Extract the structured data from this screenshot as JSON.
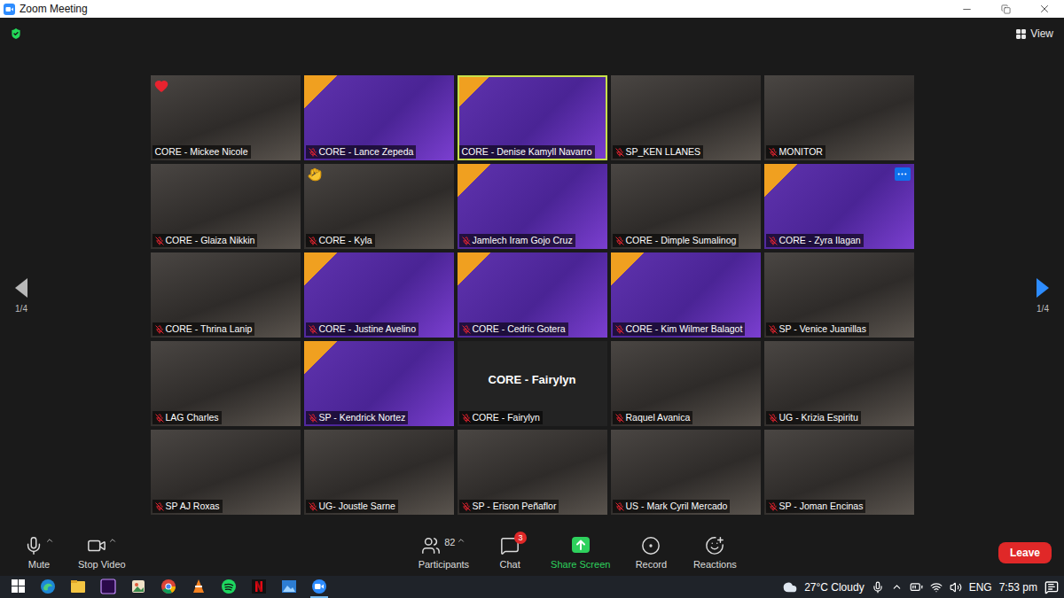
{
  "window": {
    "title": "Zoom Meeting"
  },
  "view_button": {
    "label": "View"
  },
  "pagination": {
    "previous": {
      "label": "1/4",
      "enabled": false
    },
    "next": {
      "label": "1/4",
      "enabled": true
    }
  },
  "tiles": [
    {
      "name": "CORE - Mickee Nicole",
      "kind": "camera",
      "muted": false,
      "speaking": false,
      "reaction": "heart",
      "hovered": false
    },
    {
      "name": "CORE - Lance Zepeda",
      "kind": "virtual-background",
      "muted": true,
      "speaking": false,
      "reaction": "",
      "hovered": false
    },
    {
      "name": "CORE - Denise Kamyll Navarro",
      "kind": "virtual-background",
      "muted": false,
      "speaking": true,
      "reaction": "",
      "hovered": false
    },
    {
      "name": "SP_KEN LLANES",
      "kind": "camera",
      "muted": true,
      "speaking": false,
      "reaction": "",
      "hovered": false
    },
    {
      "name": "MONITOR",
      "kind": "camera",
      "muted": true,
      "speaking": false,
      "reaction": "",
      "hovered": false
    },
    {
      "name": "CORE - Glaiza Nikkin",
      "kind": "camera",
      "muted": true,
      "speaking": false,
      "reaction": "",
      "hovered": false
    },
    {
      "name": "CORE - Kyla",
      "kind": "camera",
      "muted": true,
      "speaking": false,
      "reaction": "clap",
      "hovered": false
    },
    {
      "name": "Jamlech Iram Gojo Cruz",
      "kind": "virtual-background",
      "muted": true,
      "speaking": false,
      "reaction": "",
      "hovered": false
    },
    {
      "name": "CORE - Dimple Sumalinog",
      "kind": "camera",
      "muted": true,
      "speaking": false,
      "reaction": "",
      "hovered": false
    },
    {
      "name": "CORE - Zyra Ilagan",
      "kind": "virtual-background",
      "muted": true,
      "speaking": false,
      "reaction": "",
      "hovered": true
    },
    {
      "name": "CORE - Thrina Lanip",
      "kind": "camera",
      "muted": true,
      "speaking": false,
      "reaction": "",
      "hovered": false
    },
    {
      "name": "CORE - Justine Avelino",
      "kind": "virtual-background",
      "muted": true,
      "speaking": false,
      "reaction": "",
      "hovered": false
    },
    {
      "name": "CORE - Cedric Gotera",
      "kind": "virtual-background",
      "muted": true,
      "speaking": false,
      "reaction": "",
      "hovered": false
    },
    {
      "name": "CORE - Kim Wilmer Balagot",
      "kind": "virtual-background",
      "muted": true,
      "speaking": false,
      "reaction": "",
      "hovered": false
    },
    {
      "name": "SP - Venice Juanillas",
      "kind": "camera",
      "muted": true,
      "speaking": false,
      "reaction": "",
      "hovered": false
    },
    {
      "name": "LAG Charles",
      "kind": "camera",
      "muted": true,
      "speaking": false,
      "reaction": "",
      "hovered": false
    },
    {
      "name": "SP - Kendrick Nortez",
      "kind": "virtual-background",
      "muted": true,
      "speaking": false,
      "reaction": "",
      "hovered": false
    },
    {
      "name": "CORE - Fairylyn",
      "kind": "no-video",
      "muted": true,
      "speaking": false,
      "reaction": "",
      "hovered": false
    },
    {
      "name": "Raquel Avanica",
      "kind": "camera",
      "muted": true,
      "speaking": false,
      "reaction": "",
      "hovered": false
    },
    {
      "name": "UG - Krizia Espiritu",
      "kind": "camera",
      "muted": true,
      "speaking": false,
      "reaction": "",
      "hovered": false
    },
    {
      "name": "SP AJ Roxas",
      "kind": "camera",
      "muted": true,
      "speaking": false,
      "reaction": "",
      "hovered": false
    },
    {
      "name": "UG- Joustle Sarne",
      "kind": "camera",
      "muted": true,
      "speaking": false,
      "reaction": "",
      "hovered": false
    },
    {
      "name": "SP - Erison Peñaflor",
      "kind": "camera",
      "muted": true,
      "speaking": false,
      "reaction": "",
      "hovered": false
    },
    {
      "name": "US - Mark Cyril Mercado",
      "kind": "camera",
      "muted": true,
      "speaking": false,
      "reaction": "",
      "hovered": false
    },
    {
      "name": "SP - Joman Encinas",
      "kind": "camera",
      "muted": true,
      "speaking": false,
      "reaction": "",
      "hovered": false
    }
  ],
  "toolbar": {
    "items": [
      {
        "label": "Mute",
        "kind": "mute",
        "has_menu": true,
        "count": "",
        "badge": ""
      },
      {
        "label": "Stop Video",
        "kind": "video",
        "has_menu": true,
        "count": "",
        "badge": ""
      },
      {
        "label": "Participants",
        "kind": "participants",
        "has_menu": true,
        "count": "82",
        "badge": ""
      },
      {
        "label": "Chat",
        "kind": "chat",
        "has_menu": false,
        "count": "",
        "badge": "3"
      },
      {
        "label": "Share Screen",
        "kind": "share",
        "has_menu": false,
        "count": "",
        "badge": ""
      },
      {
        "label": "Record",
        "kind": "record",
        "has_menu": false,
        "count": "",
        "badge": ""
      },
      {
        "label": "Reactions",
        "kind": "reactions",
        "has_menu": false,
        "count": "",
        "badge": ""
      }
    ],
    "leave": "Leave"
  },
  "taskbar": {
    "weather": "27°C Cloudy",
    "language": "ENG",
    "time": "7:53 pm"
  }
}
